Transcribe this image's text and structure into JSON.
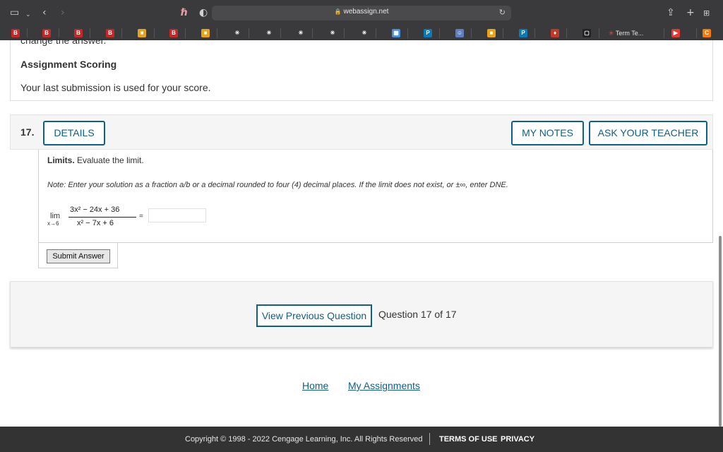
{
  "browser": {
    "url": "webassign.net",
    "favorites": [
      {
        "icon": "bookmark-b-icon",
        "glyph": "B",
        "color": "#c62828"
      },
      {
        "icon": "bookmark-b-icon",
        "glyph": "B",
        "color": "#c62828"
      },
      {
        "icon": "bookmark-b-icon",
        "glyph": "B",
        "color": "#c62828"
      },
      {
        "icon": "bookmark-b-icon",
        "glyph": "B",
        "color": "#c62828"
      },
      {
        "icon": "microsoft-icon",
        "glyph": "■",
        "color": "#e8a317"
      },
      {
        "icon": "bookmark-b-icon",
        "glyph": "B",
        "color": "#c62828"
      },
      {
        "icon": "microsoft-icon",
        "glyph": "■",
        "color": "#e8a317"
      },
      {
        "icon": "spinner-icon",
        "glyph": "✳",
        "color": "#3a3a3c"
      },
      {
        "icon": "spinner-icon",
        "glyph": "✳",
        "color": "#3a3a3c"
      },
      {
        "icon": "spinner-icon",
        "glyph": "✳",
        "color": "#3a3a3c"
      },
      {
        "icon": "spinner-icon",
        "glyph": "✳",
        "color": "#3a3a3c"
      },
      {
        "icon": "spinner-icon",
        "glyph": "✳",
        "color": "#3a3a3c"
      },
      {
        "icon": "grid-icon",
        "glyph": "▦",
        "color": "#4a90d9"
      },
      {
        "icon": "pearson-icon",
        "glyph": "P",
        "color": "#0a7bb8"
      },
      {
        "icon": "mascot-icon",
        "glyph": "☺",
        "color": "#5e7fc1"
      },
      {
        "icon": "microsoft-icon",
        "glyph": "■",
        "color": "#e8a317"
      },
      {
        "icon": "pearson-icon",
        "glyph": "P",
        "color": "#0a7bb8"
      },
      {
        "icon": "fire-icon",
        "glyph": "♦",
        "color": "#c0392b"
      },
      {
        "icon": "square-icon",
        "glyph": "▢",
        "color": "#222222"
      }
    ],
    "tab_label": "Term Te...",
    "extra_icons": [
      {
        "icon": "youtube-icon",
        "glyph": "▶",
        "color": "#e53935"
      },
      {
        "icon": "c-app-icon",
        "glyph": "C",
        "color": "#f57c00"
      }
    ]
  },
  "scoring": {
    "cut_text": "change the answer.",
    "title": "Assignment Scoring",
    "text": "Your last submission is used for your score."
  },
  "question": {
    "number": "17.",
    "details_label": "DETAILS",
    "my_notes_label": "MY NOTES",
    "ask_teacher_label": "ASK YOUR TEACHER",
    "heading_bold": "Limits.",
    "heading_text": "Evaluate the limit.",
    "note": "Note: Enter your solution as a fraction a/b or a decimal rounded to four (4) decimal places. If the limit does not exist, or ±∞, enter DNE.",
    "lim_word": "lim",
    "lim_sub": "x→6",
    "numerator": "3x² − 24x + 36",
    "denominator": "x² − 7x + 6",
    "equals": "=",
    "answer_value": "",
    "submit_label": "Submit Answer"
  },
  "navigation": {
    "prev_label": "View Previous Question",
    "count_text": "Question 17 of 17"
  },
  "links": {
    "home": "Home",
    "assignments": "My Assignments"
  },
  "footer": {
    "copyright": "Copyright © 1998 - 2022 Cengage Learning, Inc. All Rights Reserved",
    "terms": "TERMS OF USE",
    "privacy": "PRIVACY"
  },
  "colors": {
    "brand_blue": "#0f6085",
    "footer_bg": "#333333",
    "panel_bg": "#f5f5f5"
  }
}
